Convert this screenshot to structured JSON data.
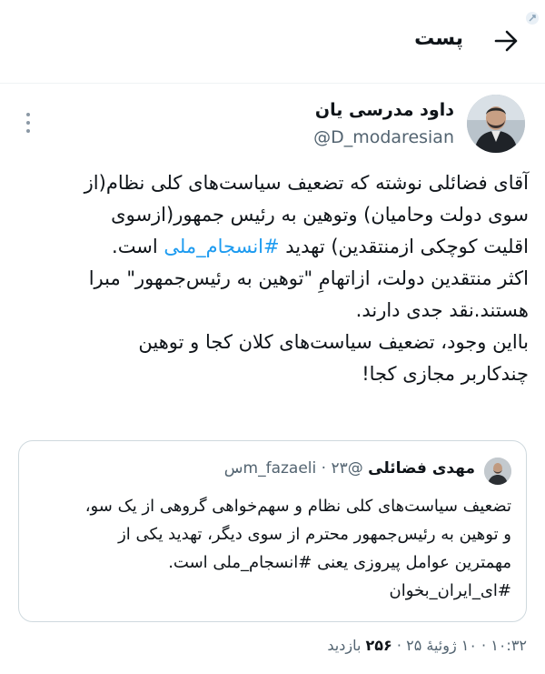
{
  "header": {
    "title": "پست"
  },
  "author": {
    "name": "داود مدرسی یان",
    "handle": "@D_modaresian"
  },
  "tweet": {
    "line1": "آقای فضائلی نوشته که تضعیف سیاست‌های کلی نظام(از",
    "line2": "سوی دولت وحامیان) وتوهین به رئیس جمهور(ازسوی",
    "line3_pre": "اقلیت کوچکی ازمنتقدین) تهدید ",
    "line3_tag": "#انسجام_ملی",
    "line3_post": " است.",
    "line4": "اکثر منتقدین دولت، ازاتهامِ \"توهین به رئیس‌جمهور\" مبرا",
    "line5": "هستند.نقد جدی دارند.",
    "line6": "بااین وجود، تضعیف سیاست‌های کلان کجا و توهین",
    "line7": "چندکاربر مجازی کجا!"
  },
  "quote": {
    "name": "مهدی فضائلی",
    "handle": "@m_fazaeli",
    "separator": "·",
    "time": "۲۳س",
    "line1": "تضعیف سیاست‌های کلی نظام و سهم‌خواهی گروهی از یک سو،",
    "line2": "و توهین به رئیس‌جمهور محترم از سوی دیگر، تهدید یکی از",
    "line3": "مهمترین عوامل پیروزی یعنی #انسجام_ملی است.",
    "line4": "#ای_ایران_بخوان"
  },
  "meta": {
    "time": "۱۰:۳۲",
    "date": "۱۰ ژوئیهٔ ۲۵",
    "separator": "·",
    "views": "۲۵۶",
    "views_label": "بازدید"
  }
}
